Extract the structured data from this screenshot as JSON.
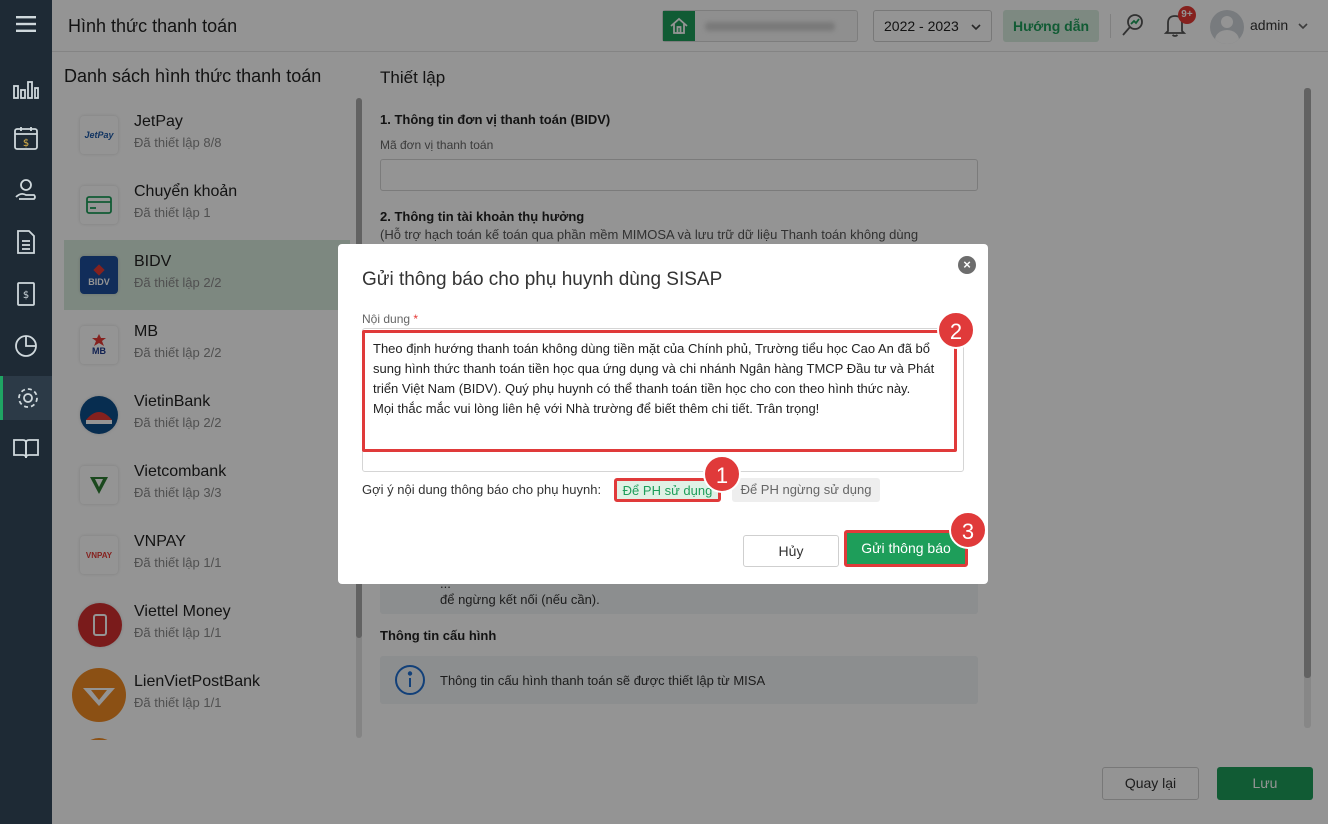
{
  "header": {
    "title": "Hình thức thanh toán",
    "year": "2022 - 2023",
    "guide_label": "Hướng dẫn",
    "notification_count": "9+",
    "username": "admin"
  },
  "sidebar": {
    "icons": [
      "menu-icon",
      "chart-icon",
      "calendar-money-icon",
      "hand-coin-icon",
      "document-icon",
      "money-book-icon",
      "pie-chart-icon",
      "gear-icon",
      "open-book-icon"
    ]
  },
  "payment_list": {
    "title": "Danh sách hình thức thanh toán",
    "items": [
      {
        "name": "JetPay",
        "status": "Đã thiết lập 8/8",
        "logo_text": "JetPay"
      },
      {
        "name": "Chuyển khoản",
        "status": "Đã thiết lập 1",
        "logo_text": ""
      },
      {
        "name": "BIDV",
        "status": "Đã thiết lập 2/2",
        "logo_text": "BIDV"
      },
      {
        "name": "MB",
        "status": "Đã thiết lập 2/2",
        "logo_text": "MB"
      },
      {
        "name": "VietinBank",
        "status": "Đã thiết lập 2/2",
        "logo_text": ""
      },
      {
        "name": "Vietcombank",
        "status": "Đã thiết lập 3/3",
        "logo_text": ""
      },
      {
        "name": "VNPAY",
        "status": "Đã thiết lập 1/1",
        "logo_text": "VNPAY"
      },
      {
        "name": "Viettel Money",
        "status": "Đã thiết lập 1/1",
        "logo_text": ""
      },
      {
        "name": "LienVietPostBank",
        "status": "Đã thiết lập 1/1",
        "logo_text": ""
      }
    ],
    "active_index": 2
  },
  "settings": {
    "title": "Thiết lập",
    "section1_title": "1. Thông tin đơn vị thanh toán (BIDV)",
    "unit_code_label": "Mã đơn vị thanh toán",
    "unit_code_value": "",
    "section2_title": "2. Thông tin tài khoản thụ hưởng",
    "section2_desc": "(Hỗ trợ hạch toán kế toán qua phần mềm MIMOSA và lưu trữ dữ liệu Thanh toán không dùng",
    "info1_line1": "...",
    "info1_line2": "để ngừng kết nối (nếu cần).",
    "config_title": "Thông tin cấu hình",
    "config_info": "Thông tin cấu hình thanh toán sẽ được thiết lập từ MISA"
  },
  "footer": {
    "back_label": "Quay lại",
    "save_label": "Lưu"
  },
  "modal": {
    "title": "Gửi thông báo cho phụ huynh dùng SISAP",
    "content_label": "Nội dung",
    "required_mark": "*",
    "message_line1": "Theo định hướng thanh toán không dùng tiền mặt của Chính phủ, Trường tiểu học Cao An đã bổ sung hình thức thanh toán tiền học qua ứng dụng và chi nhánh Ngân hàng TMCP Đầu tư và Phát triển Việt Nam (BIDV). Quý phụ huynh có thể thanh toán tiền học cho con theo hình thức này.",
    "message_line2": "Mọi thắc mắc vui lòng liên hệ với Nhà trường để biết thêm chi tiết. Trân trọng!",
    "suggest_label": "Gợi ý nội dung thông báo cho phụ huynh:",
    "suggest_use": "Để PH sử dụng",
    "suggest_stop": "Để PH ngừng sử dụng",
    "cancel_label": "Hủy",
    "send_label": "Gửi thông báo"
  },
  "steps": {
    "one": "1",
    "two": "2",
    "three": "3"
  },
  "colors": {
    "brand_green": "#1e9e5a",
    "highlight_red": "#e03a3a",
    "rail_bg": "#1e2a35"
  }
}
